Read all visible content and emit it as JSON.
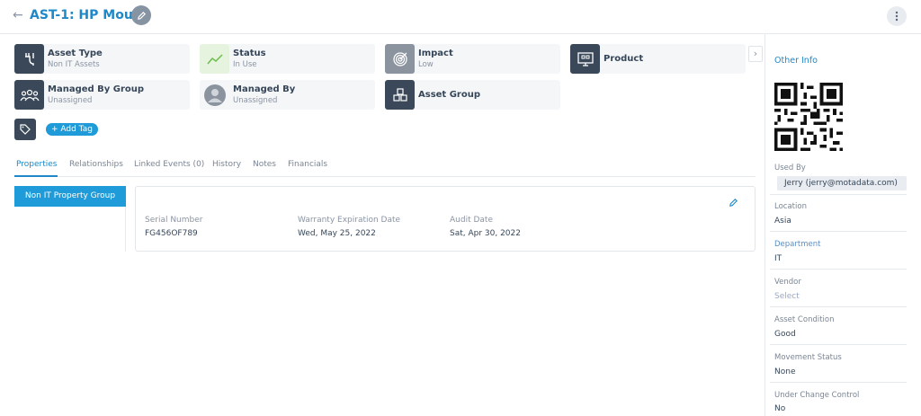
{
  "header": {
    "title": "AST-1: HP Mouse"
  },
  "cards": [
    {
      "label": "Asset Type",
      "value": "Non IT Assets",
      "icon": "connector-icon"
    },
    {
      "label": "Status",
      "value": "In Use",
      "icon": "trend-icon"
    },
    {
      "label": "Impact",
      "value": "Low",
      "icon": "target-icon"
    },
    {
      "label": "Product",
      "value": "",
      "icon": "monitor-icon"
    },
    {
      "label": "Managed By Group",
      "value": "Unassigned",
      "icon": "group-icon"
    },
    {
      "label": "Managed By",
      "value": "Unassigned",
      "icon": "user-icon"
    },
    {
      "label": "Asset Group",
      "value": "",
      "icon": "boxes-icon"
    }
  ],
  "tags": {
    "add_label": "+ Add Tag"
  },
  "tabs": [
    "Properties",
    "Relationships",
    "Linked Events (0)",
    "History",
    "Notes",
    "Financials"
  ],
  "property_group": "Non IT Property Group",
  "properties": [
    {
      "label": "Serial Number",
      "value": "FG456OF789"
    },
    {
      "label": "Warranty Expiration Date",
      "value": "Wed, May 25, 2022"
    },
    {
      "label": "Audit Date",
      "value": "Sat, Apr 30, 2022"
    }
  ],
  "sidebar": {
    "title": "Other Info",
    "used_by_label": "Used By",
    "used_by_value": "Jerry (jerry@motadata.com)",
    "fields": [
      {
        "label": "Location",
        "value": "Asia"
      },
      {
        "label": "Department",
        "value": "IT"
      },
      {
        "label": "Vendor",
        "value": "Select"
      },
      {
        "label": "Asset Condition",
        "value": "Good"
      },
      {
        "label": "Movement Status",
        "value": "None"
      },
      {
        "label": "Under Change Control",
        "value": "No"
      }
    ]
  },
  "colors": {
    "accent": "#1e88c8",
    "button": "#1e9bd8",
    "icon_bg": "#3a4859",
    "card_bg": "#f4f6f8"
  }
}
